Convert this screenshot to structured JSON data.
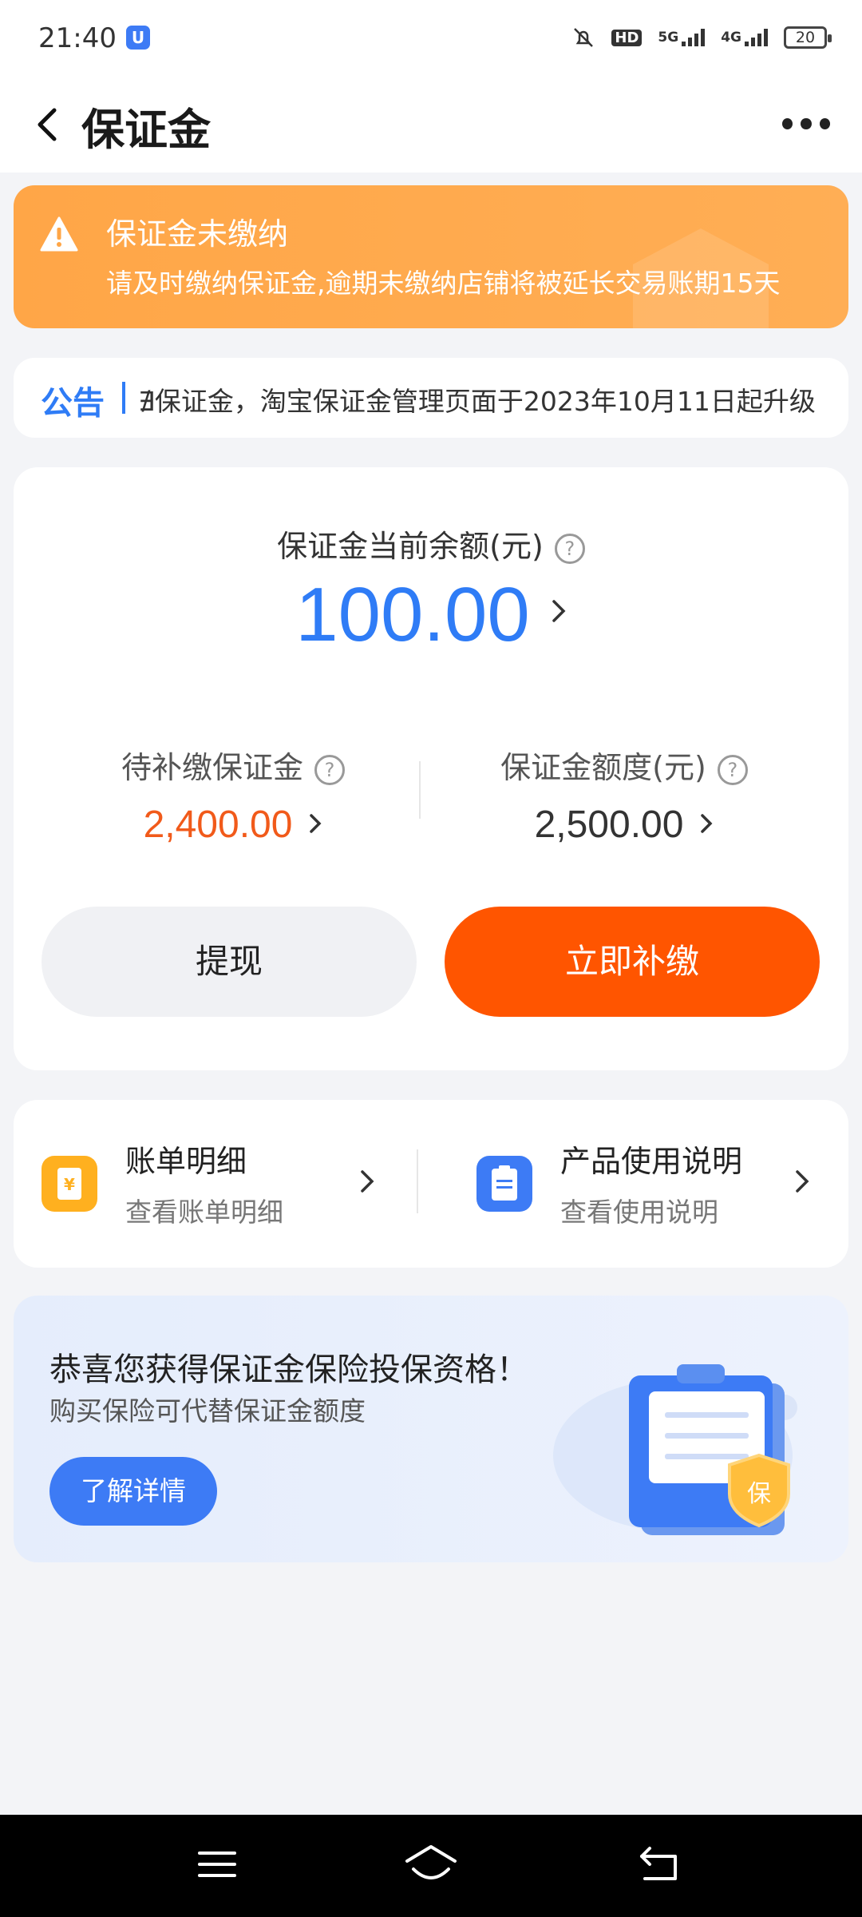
{
  "status_bar": {
    "time": "21:40",
    "network_hd": "HD",
    "network_5g": "5G",
    "network_4g": "4G",
    "battery": "20"
  },
  "nav": {
    "title": "保证金"
  },
  "warning": {
    "title": "保证金未缴纳",
    "text": "请及时缴纳保证金,逾期未缴纳店铺将被延长交易账期15天"
  },
  "notice": {
    "tag": "公告",
    "text": "∄保证金，淘宝保证金管理页面于2023年10月11日起升级"
  },
  "balance": {
    "label": "保证金当前余额(元)",
    "amount": "100.00",
    "pending_label": "待补缴保证金",
    "pending_value": "2,400.00",
    "quota_label": "保证金额度(元)",
    "quota_value": "2,500.00",
    "withdraw_label": "提现",
    "pay_label": "立即补缴"
  },
  "shortcuts": [
    {
      "title": "账单明细",
      "subtitle": "查看账单明细",
      "icon": "bill-icon"
    },
    {
      "title": "产品使用说明",
      "subtitle": "查看使用说明",
      "icon": "document-icon"
    }
  ],
  "promo": {
    "title": "恭喜您获得保证金保险投保资格！",
    "subtitle": "购买保险可代替保证金额度",
    "button": "了解详情",
    "badge": "保"
  },
  "colors": {
    "accent_blue": "#2f7cf6",
    "accent_orange": "#ff5500",
    "warning_orange": "#ffa647",
    "pending_red": "#f15a1a"
  }
}
